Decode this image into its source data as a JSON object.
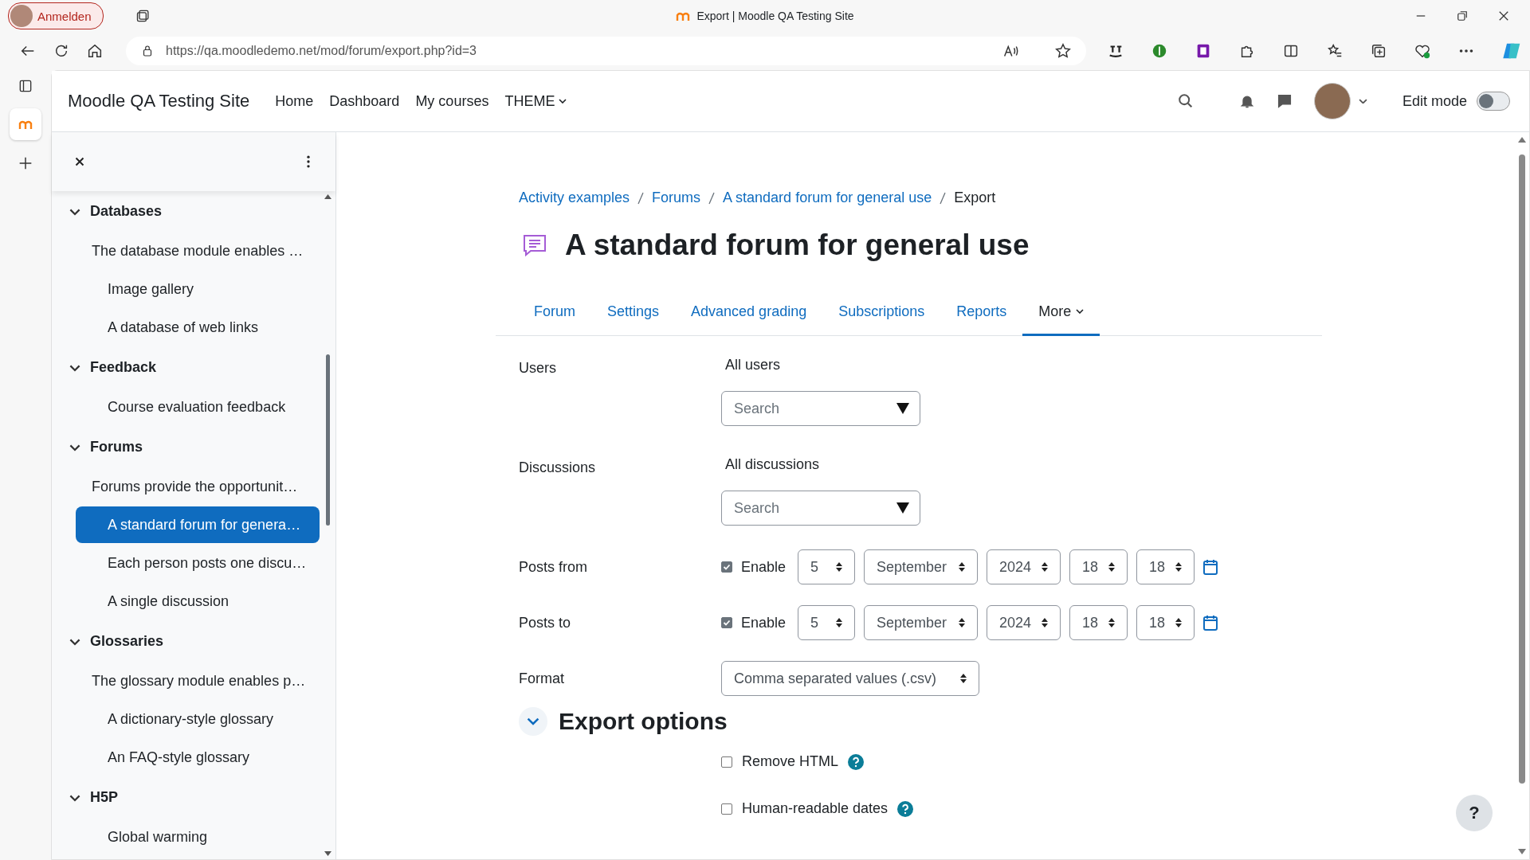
{
  "browser": {
    "profile_button": "Anmelden",
    "tab_title": "Export | Moodle QA Testing Site",
    "url": "https://qa.moodledemo.net/mod/forum/export.php?id=3"
  },
  "navbar": {
    "site_name": "Moodle QA Testing Site",
    "links": [
      {
        "label": "Home",
        "dropdown": false
      },
      {
        "label": "Dashboard",
        "dropdown": false
      },
      {
        "label": "My courses",
        "dropdown": false
      },
      {
        "label": "THEME",
        "dropdown": true
      }
    ],
    "edit_mode": {
      "label": "Edit mode",
      "on": false
    }
  },
  "drawer": {
    "items": [
      {
        "label": "Databases",
        "expanded": true,
        "children": [
          {
            "label": "The database module enables …",
            "kind": "description",
            "selected": false
          },
          {
            "label": "Image gallery",
            "kind": "activity",
            "selected": false
          },
          {
            "label": "A database of web links",
            "kind": "activity",
            "selected": false
          }
        ]
      },
      {
        "label": "Feedback",
        "expanded": true,
        "children": [
          {
            "label": "Course evaluation feedback",
            "kind": "activity",
            "selected": false
          }
        ]
      },
      {
        "label": "Forums",
        "expanded": true,
        "children": [
          {
            "label": "Forums provide the opportunit…",
            "kind": "description",
            "selected": false
          },
          {
            "label": "A standard forum for genera…",
            "kind": "activity",
            "selected": true
          },
          {
            "label": "Each person posts one discu…",
            "kind": "activity",
            "selected": false
          },
          {
            "label": "A single discussion",
            "kind": "activity",
            "selected": false
          }
        ]
      },
      {
        "label": "Glossaries",
        "expanded": true,
        "children": [
          {
            "label": "The glossary module enables p…",
            "kind": "description",
            "selected": false
          },
          {
            "label": "A dictionary-style glossary",
            "kind": "activity",
            "selected": false
          },
          {
            "label": "An FAQ-style glossary",
            "kind": "activity",
            "selected": false
          }
        ]
      },
      {
        "label": "H5P",
        "expanded": true,
        "children": [
          {
            "label": "Global warming",
            "kind": "activity",
            "selected": false
          }
        ]
      }
    ]
  },
  "main": {
    "breadcrumb": [
      "Activity examples",
      "Forums",
      "A standard forum for general use",
      "Export"
    ],
    "heading": "A standard forum for general use",
    "tabs": [
      {
        "label": "Forum",
        "selected": false,
        "dropdown": false
      },
      {
        "label": "Settings",
        "selected": false,
        "dropdown": false
      },
      {
        "label": "Advanced grading",
        "selected": false,
        "dropdown": false
      },
      {
        "label": "Subscriptions",
        "selected": false,
        "dropdown": false
      },
      {
        "label": "Reports",
        "selected": false,
        "dropdown": false
      },
      {
        "label": "More",
        "selected": true,
        "dropdown": true
      }
    ],
    "users": {
      "label": "Users",
      "value": "All users",
      "placeholder": "Search"
    },
    "discussions": {
      "label": "Discussions",
      "value": "All discussions",
      "placeholder": "Search"
    },
    "dates": [
      {
        "label": "Posts from",
        "enable": {
          "label": "Enable",
          "checked": true
        },
        "day": "5",
        "month": "September",
        "year": "2024",
        "hour": "18",
        "minute": "18"
      },
      {
        "label": "Posts to",
        "enable": {
          "label": "Enable",
          "checked": true
        },
        "day": "5",
        "month": "September",
        "year": "2024",
        "hour": "18",
        "minute": "18"
      }
    ],
    "format": {
      "label": "Format",
      "value": "Comma separated values (.csv)"
    },
    "export_options": {
      "title": "Export options",
      "expanded": true,
      "options": [
        {
          "label": "Remove HTML",
          "checked": false
        },
        {
          "label": "Human-readable dates",
          "checked": false
        }
      ]
    },
    "help_button": "?"
  }
}
